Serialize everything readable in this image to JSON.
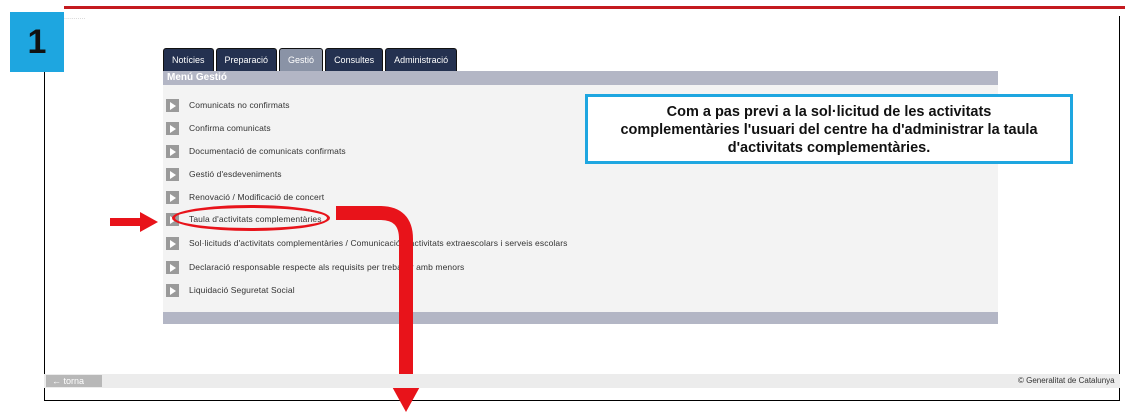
{
  "step_number": "1",
  "header_fragment": "...........",
  "tabs": [
    {
      "label": "Notícies",
      "active": false
    },
    {
      "label": "Preparació",
      "active": false
    },
    {
      "label": "Gestió",
      "active": true
    },
    {
      "label": "Consultes",
      "active": false
    },
    {
      "label": "Administració",
      "active": false
    }
  ],
  "menu": {
    "title": "Menú Gestió",
    "items": [
      {
        "label": "Comunicats no confirmats"
      },
      {
        "label": "Confirma comunicats"
      },
      {
        "label": "Documentació de comunicats confirmats"
      },
      {
        "label": "Gestió d'esdeveniments"
      },
      {
        "label": "Renovació / Modificació de concert"
      },
      {
        "label": "Taula d'activitats complementàries"
      },
      {
        "label": "Sol·licituds d'activitats complementàries / Comunicació d'activitats extraescolars i serveis escolars"
      },
      {
        "label": "Declaració responsable respecte als requisits per treballar amb menors"
      },
      {
        "label": "Liquidació Seguretat Social"
      }
    ]
  },
  "callout": {
    "line1": "Com a pas previ a la sol·licitud de les activitats",
    "line2": "complementàries l'usuari del centre ha d'administrar la taula",
    "line3": "d'activitats complementàries."
  },
  "footer": {
    "back_label": "← torna",
    "copyright": "© Generalitat de Catalunya"
  },
  "colors": {
    "accent_red": "#e8131a",
    "callout_blue": "#1ea6e0",
    "tab_dark": "#243150"
  }
}
